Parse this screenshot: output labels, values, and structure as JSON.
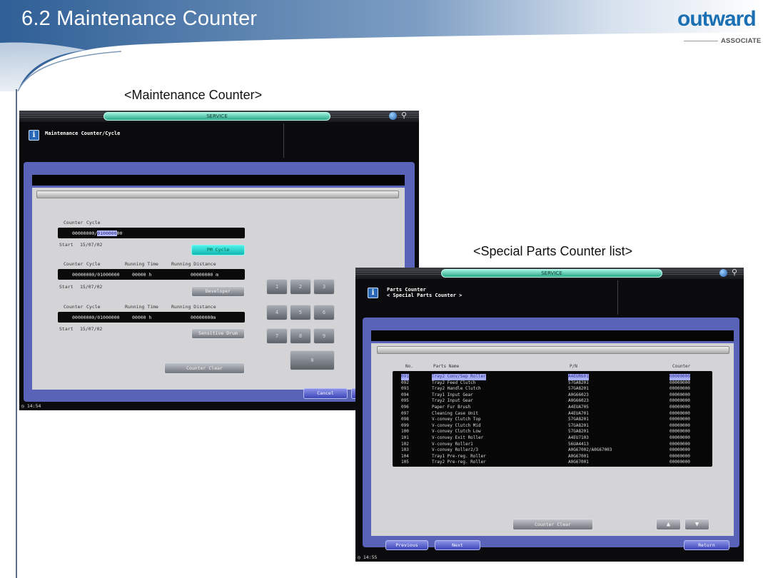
{
  "slide": {
    "title": "6.2 Maintenance Counter",
    "logo_text": "outward",
    "logo_sub": "ASSOCIATE"
  },
  "captions": {
    "left": "<Maintenance Counter>",
    "right": "<Special Parts Counter list>"
  },
  "maintenance_screen": {
    "service_label": "SERVICE",
    "header_title": "Maintenance Counter/Cycle",
    "groups": [
      {
        "col_labels": [
          "Counter",
          "Cycle"
        ],
        "value_left": "00000000/",
        "value_highlight": "0100000",
        "value_right": "00",
        "start_label": "Start",
        "start_date": "15/07/02",
        "button": "PM Cycle"
      },
      {
        "col_labels": [
          "Counter",
          "Cycle",
          "Running Time",
          "Running Distance"
        ],
        "values": [
          "00000000/01000000",
          "00000 h",
          "00000000 m"
        ],
        "start_label": "Start",
        "start_date": "15/07/02",
        "button": "Developer"
      },
      {
        "col_labels": [
          "Counter",
          "Cycle",
          "Running Time",
          "Running Distance"
        ],
        "values": [
          "00000000/01000000",
          "00000 h",
          "00000000m"
        ],
        "start_label": "Start",
        "start_date": "15/07/02",
        "button": "Sensitive Drum"
      }
    ],
    "keypad": [
      "1",
      "2",
      "3",
      "4",
      "5",
      "6",
      "7",
      "8",
      "9",
      "0"
    ],
    "counter_clear": "Counter Clear",
    "cancel": "Cancel",
    "clock": "14:54"
  },
  "parts_screen": {
    "service_label": "SERVICE",
    "header_line1": "Parts Counter",
    "header_line2": "< Special Parts Counter >",
    "columns": [
      "No.",
      "Parts Name",
      "P/N",
      "Counter"
    ],
    "rows": [
      {
        "no": "091",
        "name": "Tray2 Conv/Sep Roller",
        "pn": "A4EUR601",
        "counter": "00000000"
      },
      {
        "no": "092",
        "name": "Tray2 Feed Clutch",
        "pn": "57GA8201",
        "counter": "00000000"
      },
      {
        "no": "093",
        "name": "Tray2 Handle Clutch",
        "pn": "57GA8201",
        "counter": "00000000"
      },
      {
        "no": "094",
        "name": "Tray1 Input Gear",
        "pn": "A0G66023",
        "counter": "00000000"
      },
      {
        "no": "095",
        "name": "Tray2 Input Gear",
        "pn": "A0G66023",
        "counter": "00000000"
      },
      {
        "no": "096",
        "name": "Paper Fur Brush",
        "pn": "A4EUA705",
        "counter": "00000000"
      },
      {
        "no": "097",
        "name": "Cleaning Case Unit",
        "pn": "A4EUA701",
        "counter": "00000000"
      },
      {
        "no": "098",
        "name": "V-convey Clutch Top",
        "pn": "57GA8201",
        "counter": "00000000"
      },
      {
        "no": "099",
        "name": "V-convey Clutch Mid",
        "pn": "57GA8201",
        "counter": "00000000"
      },
      {
        "no": "100",
        "name": "V-convey Clutch Low",
        "pn": "57GA8201",
        "counter": "00000000"
      },
      {
        "no": "101",
        "name": "V-convey Exit Roller",
        "pn": "A4EU7103",
        "counter": "00000000"
      },
      {
        "no": "102",
        "name": "V-convey Roller1",
        "pn": "56UA4413",
        "counter": "00000000"
      },
      {
        "no": "103",
        "name": "V-convey Roller2/3",
        "pn": "A0G67002/A0G67003",
        "counter": "00000000"
      },
      {
        "no": "104",
        "name": "Tray1 Pre-reg. Roller",
        "pn": "A0G67001",
        "counter": "00000000"
      },
      {
        "no": "105",
        "name": "Tray2 Pre-reg. Roller",
        "pn": "A0G67001",
        "counter": "00000000"
      }
    ],
    "counter_clear": "Counter Clear",
    "previous": "Previous",
    "next": "Next",
    "return": "Return",
    "clock": "14:55"
  }
}
